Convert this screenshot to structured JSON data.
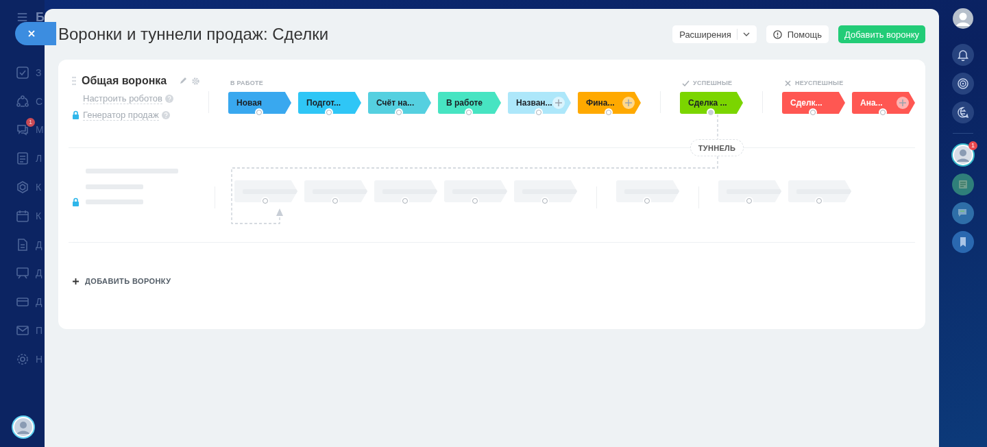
{
  "left_sidebar": {
    "logo_letter": "Б",
    "items": [
      {
        "kind": "tasks",
        "label": "З"
      },
      {
        "kind": "flows",
        "label": "С"
      },
      {
        "kind": "chat",
        "label": "М",
        "badge": "1"
      },
      {
        "kind": "list",
        "label": "Л"
      },
      {
        "kind": "hexagon",
        "label": "К"
      },
      {
        "kind": "calendar",
        "label": "К"
      },
      {
        "kind": "file",
        "label": "Д"
      },
      {
        "kind": "board",
        "label": "Д"
      },
      {
        "kind": "card",
        "label": "Д"
      },
      {
        "kind": "mail",
        "label": "П"
      },
      {
        "kind": "settings",
        "label": "Н"
      }
    ]
  },
  "panel": {
    "title": "Воронки и туннели продаж: Сделки",
    "buttons": [
      {
        "kind": "dropdown",
        "label": "Расширения"
      },
      {
        "kind": "help",
        "label": "Помощь"
      },
      {
        "kind": "primary",
        "label": "Добавить воронку"
      }
    ]
  },
  "funnel": {
    "name": "Общая воронка",
    "links": [
      {
        "label": "Настроить роботов",
        "locked": false
      },
      {
        "label": "Генератор продаж",
        "locked": true
      }
    ],
    "groups": [
      {
        "kind": "in_progress",
        "label": "В РАБОТЕ",
        "stages": [
          {
            "label": "Новая",
            "color": "#39a8ef",
            "add_button": false,
            "tunnel_source": false
          },
          {
            "label": "Подгот...",
            "color": "#2fc6f6",
            "add_button": false,
            "tunnel_source": false
          },
          {
            "label": "Счёт на...",
            "color": "#55d0e0",
            "add_button": false,
            "tunnel_source": false
          },
          {
            "label": "В работе",
            "color": "#47e4c2",
            "add_button": false,
            "tunnel_source": false
          },
          {
            "label": "Назван...",
            "color": "#ade7fa",
            "add_button": true,
            "tunnel_source": false
          },
          {
            "label": "Фина...",
            "color": "#ffa900",
            "add_button": true,
            "tunnel_source": false
          }
        ]
      },
      {
        "kind": "success",
        "label": "УСПЕШНЫЕ",
        "stages": [
          {
            "label": "Сделка ...",
            "color": "#7bd500",
            "add_button": false,
            "tunnel_source": true
          }
        ]
      },
      {
        "kind": "failure",
        "label": "НЕУСПЕШНЫЕ",
        "stages": [
          {
            "label": "Сделк...",
            "color": "#ff5752",
            "add_button": false,
            "tunnel_source": false
          },
          {
            "label": "Ана...",
            "color": "#ff5752",
            "add_button": true,
            "tunnel_source": false
          }
        ]
      }
    ]
  },
  "tunnel": {
    "label": "ТУННЕЛЬ"
  },
  "add_funnel": {
    "label": "ДОБАВИТЬ ВОРОНКУ"
  },
  "right_sidebar": {
    "items": [
      {
        "kind": "bell"
      },
      {
        "kind": "target"
      },
      {
        "kind": "exchange"
      },
      {
        "kind": "avatar",
        "badge": "1"
      },
      {
        "kind": "doc"
      },
      {
        "kind": "chat"
      },
      {
        "kind": "bookmark"
      }
    ]
  }
}
